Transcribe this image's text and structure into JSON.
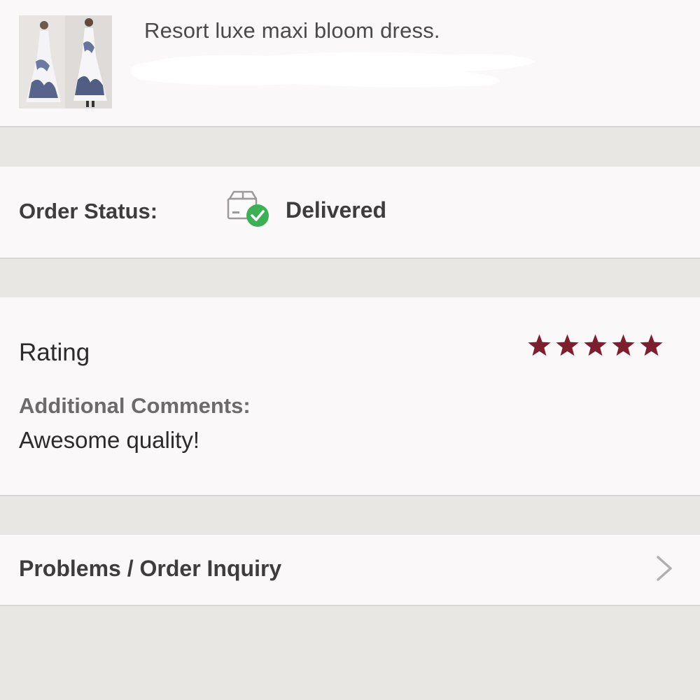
{
  "product": {
    "title": "Resort luxe maxi bloom dress.",
    "image_alt": "dress-thumbnail"
  },
  "order_status": {
    "label": "Order Status:",
    "value": "Delivered",
    "icon": "delivered-box-icon",
    "status_color": "#3cb054"
  },
  "rating": {
    "label": "Rating",
    "stars": 5,
    "max_stars": 5,
    "star_color": "#7d1f2c",
    "comments_label": "Additional Comments:",
    "comments": "Awesome quality!"
  },
  "inquiry": {
    "label": "Problems / Order Inquiry",
    "icon": "chevron-right-icon"
  }
}
